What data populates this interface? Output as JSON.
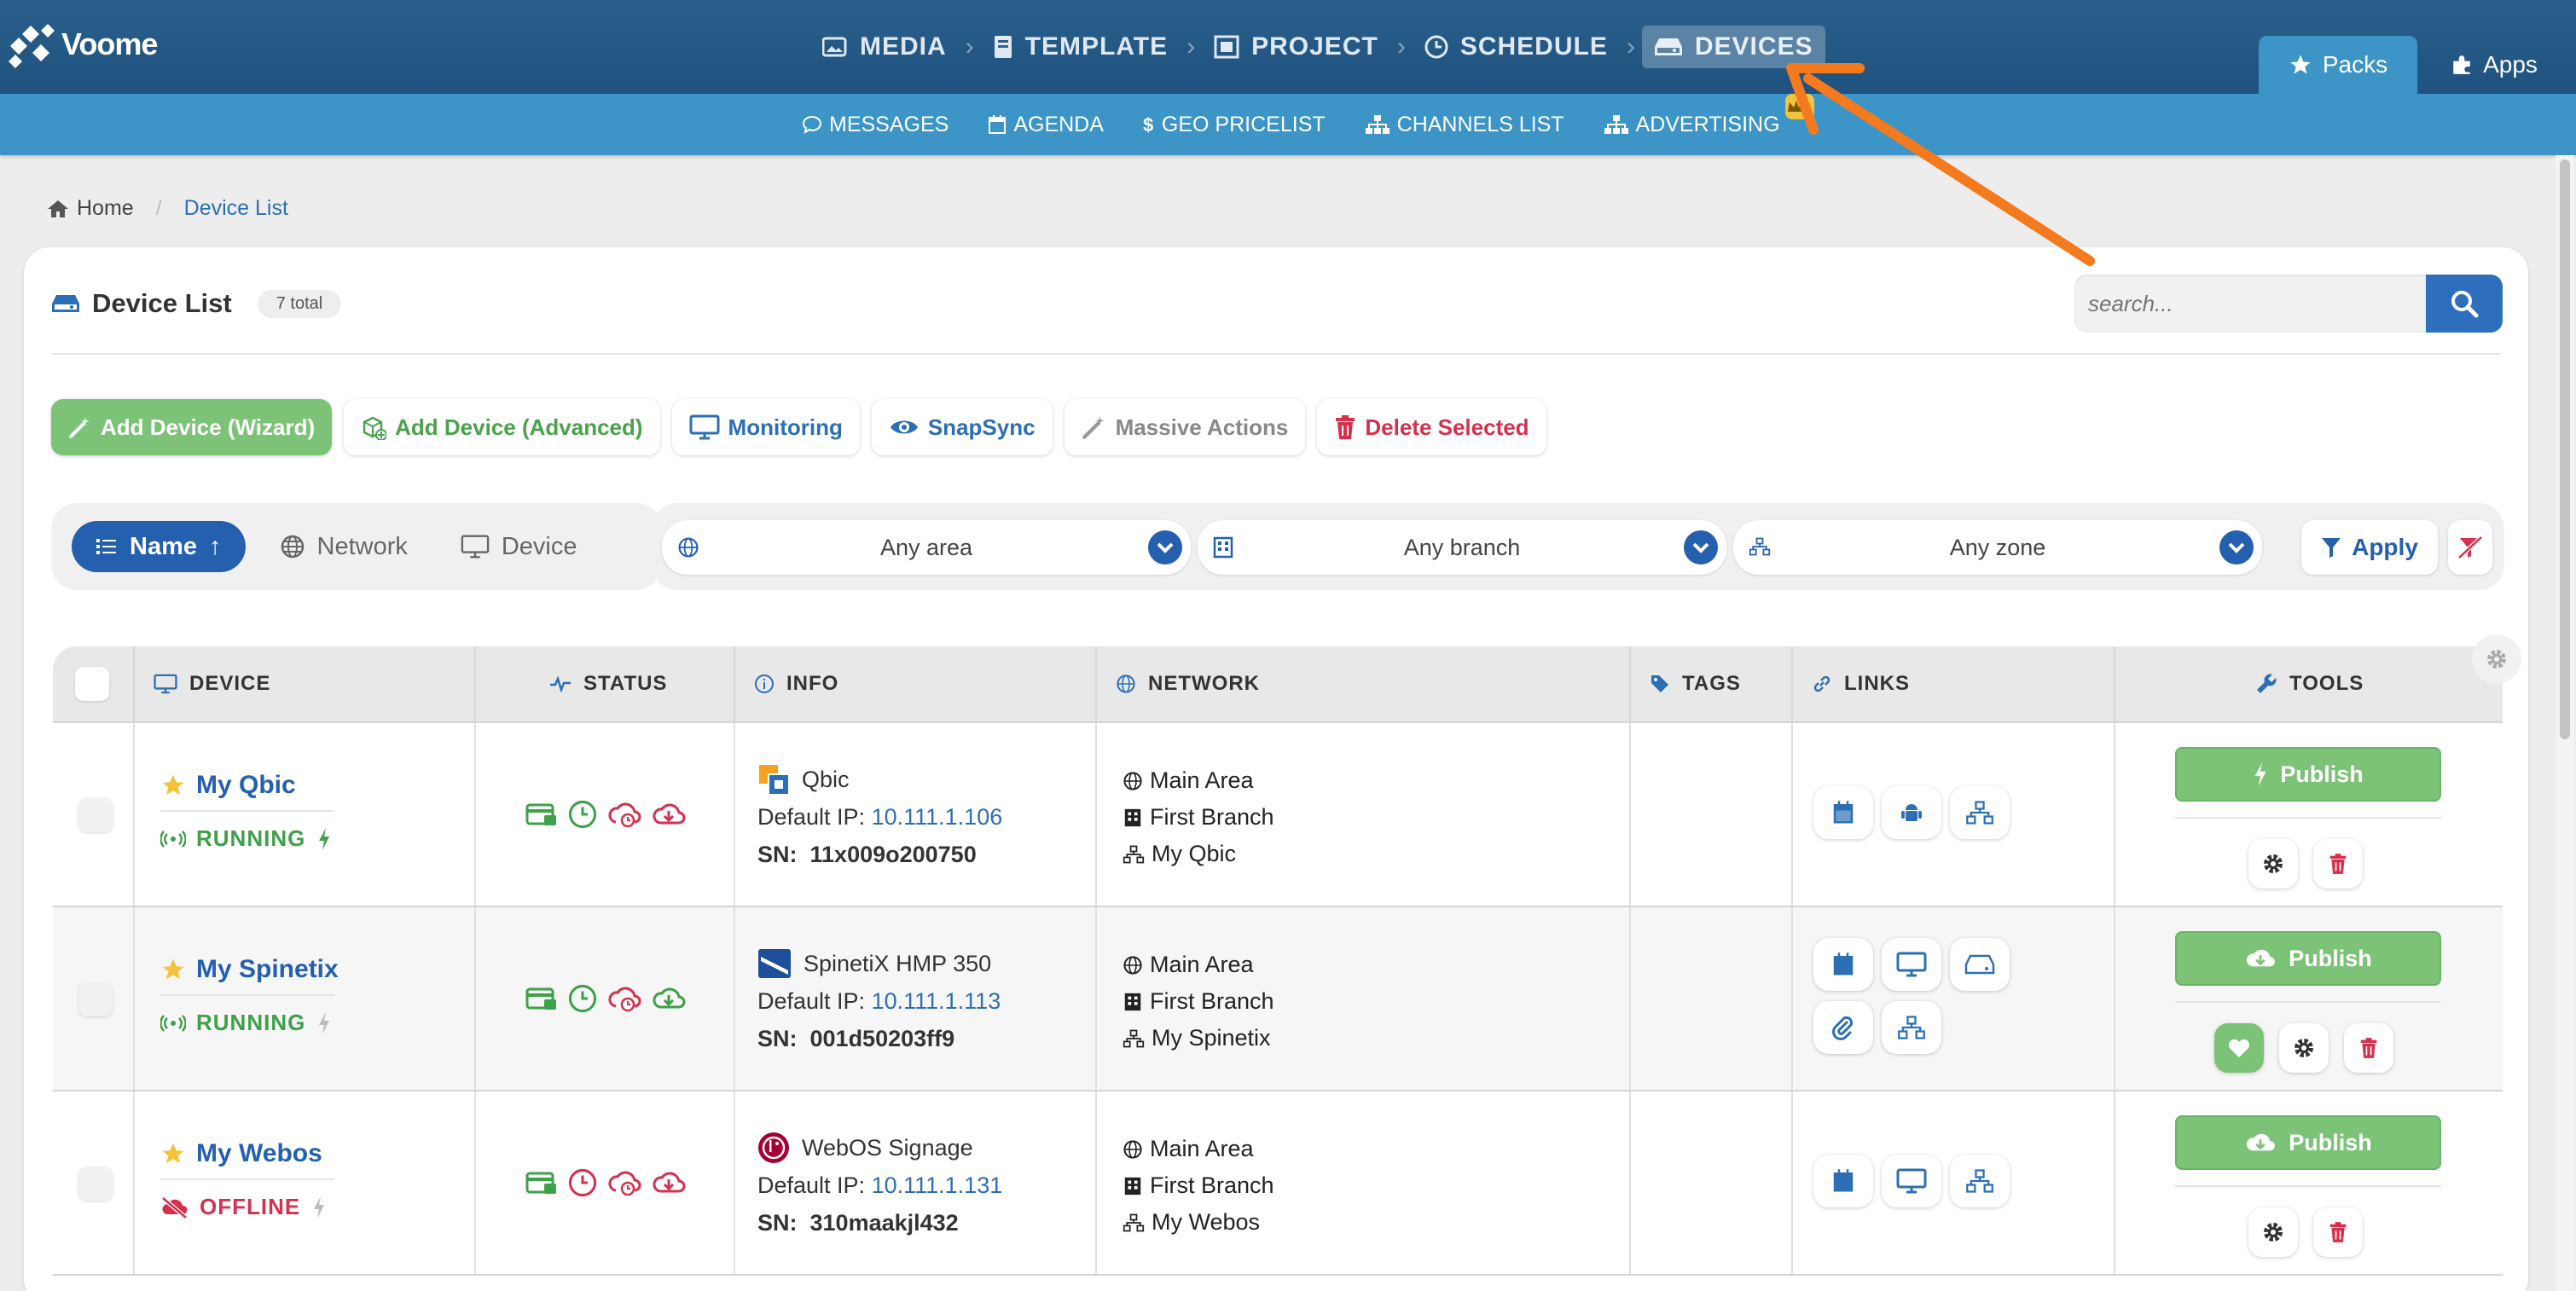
{
  "brand": {
    "name": "Voome"
  },
  "main_nav": [
    {
      "label": "MEDIA",
      "icon": "image-icon"
    },
    {
      "label": "TEMPLATE",
      "icon": "book-icon"
    },
    {
      "label": "PROJECT",
      "icon": "project-icon"
    },
    {
      "label": "SCHEDULE",
      "icon": "clock-icon"
    },
    {
      "label": "DEVICES",
      "icon": "hdd-icon",
      "active": true
    }
  ],
  "right_tabs": {
    "packs": "Packs",
    "apps": "Apps"
  },
  "sub_nav": [
    {
      "label": "MESSAGES",
      "icon": "comment-icon"
    },
    {
      "label": "AGENDA",
      "icon": "calendar-icon"
    },
    {
      "label": "GEO PRICELIST",
      "icon": "dollar-icon"
    },
    {
      "label": "CHANNELS LIST",
      "icon": "sitemap-icon"
    },
    {
      "label": "ADVERTISING",
      "icon": "sitemap-icon",
      "badge_icon": "crown-icon"
    }
  ],
  "breadcrumb": {
    "home": "Home",
    "current": "Device List"
  },
  "card": {
    "title": "Device List",
    "total": "7 total"
  },
  "search": {
    "placeholder": "search..."
  },
  "actions": {
    "add_wizard": "Add Device (Wizard)",
    "add_advanced": "Add Device (Advanced)",
    "monitoring": "Monitoring",
    "snapsync": "SnapSync",
    "massive": "Massive Actions",
    "delete_selected": "Delete Selected"
  },
  "sort": {
    "name": "Name",
    "network": "Network",
    "device": "Device"
  },
  "filters": {
    "area": "Any area",
    "branch": "Any branch",
    "zone": "Any zone",
    "apply": "Apply"
  },
  "table": {
    "headers": {
      "device": "DEVICE",
      "status": "STATUS",
      "info": "INFO",
      "network": "NETWORK",
      "tags": "TAGS",
      "links": "LINKS",
      "tools": "TOOLS"
    },
    "rows": [
      {
        "name": "My Qbic",
        "status": "RUNNING",
        "status_kind": "running",
        "bolt_color": "#3ea048",
        "model": "Qbic",
        "ip_label": "Default IP:",
        "ip": "10.111.1.106",
        "sn_label": "SN:",
        "sn": "11x009o200750",
        "area": "Main Area",
        "branch": "First Branch",
        "zone": "My Qbic",
        "publish": "Publish",
        "publish_icon": "bolt-icon"
      },
      {
        "name": "My Spinetix",
        "status": "RUNNING",
        "status_kind": "running",
        "bolt_color": "#bbbbbb",
        "model": "SpinetiX HMP 350",
        "ip_label": "Default IP:",
        "ip": "10.111.1.113",
        "sn_label": "SN:",
        "sn": "001d50203ff9",
        "area": "Main Area",
        "branch": "First Branch",
        "zone": "My Spinetix",
        "publish": "Publish",
        "publish_icon": "cloud-download-icon"
      },
      {
        "name": "My Webos",
        "status": "OFFLINE",
        "status_kind": "offline",
        "bolt_color": "#bbbbbb",
        "model": "WebOS Signage",
        "ip_label": "Default IP:",
        "ip": "10.111.1.131",
        "sn_label": "SN:",
        "sn": "310maakjl432",
        "area": "Main Area",
        "branch": "First Branch",
        "zone": "My Webos",
        "publish": "Publish",
        "publish_icon": "cloud-download-icon"
      }
    ]
  },
  "colors": {
    "accent": "#2460ae",
    "green": "#7cc377",
    "red": "#d6304f",
    "arrow": "#f47a1f"
  }
}
